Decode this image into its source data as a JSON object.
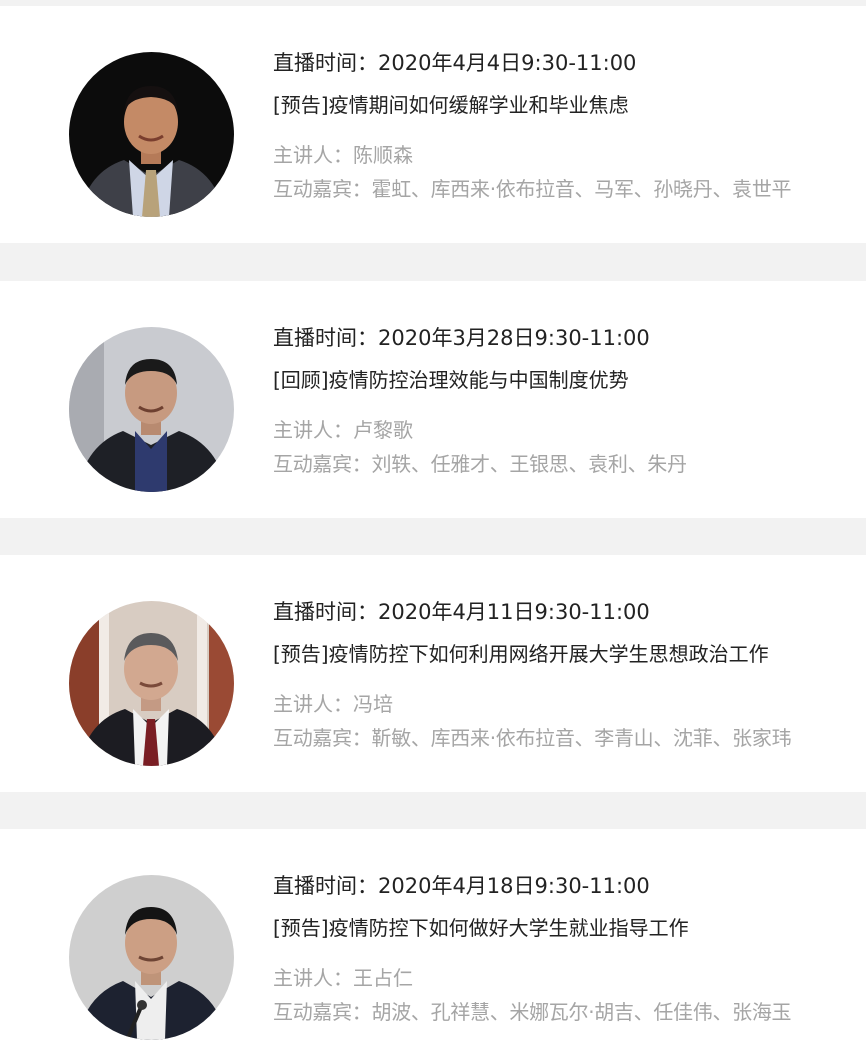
{
  "events": [
    {
      "time": "直播时间：2020年4月4日9:30-11:00",
      "title": "[预告]疫情期间如何缓解学业和毕业焦虑",
      "speaker": "主讲人：陈顺森",
      "guests": "互动嘉宾：霍虹、库西来·依布拉音、马军、孙晓丹、袁世平"
    },
    {
      "time": "直播时间：2020年3月28日9:30-11:00",
      "title": "[回顾]疫情防控治理效能与中国制度优势",
      "speaker": "主讲人：卢黎歌",
      "guests": "互动嘉宾：刘轶、任雅才、王银思、袁利、朱丹"
    },
    {
      "time": "直播时间：2020年4月11日9:30-11:00",
      "title": "[预告]疫情防控下如何利用网络开展大学生思想政治工作",
      "speaker": "主讲人：冯培",
      "guests": "互动嘉宾：靳敏、库西来·依布拉音、李青山、沈菲、张家玮"
    },
    {
      "time": "直播时间：2020年4月18日9:30-11:00",
      "title": "[预告]疫情防控下如何做好大学生就业指导工作",
      "speaker": "主讲人：王占仁",
      "guests": "互动嘉宾：胡波、孔祥慧、米娜瓦尔·胡吉、任佳伟、张海玉"
    }
  ]
}
